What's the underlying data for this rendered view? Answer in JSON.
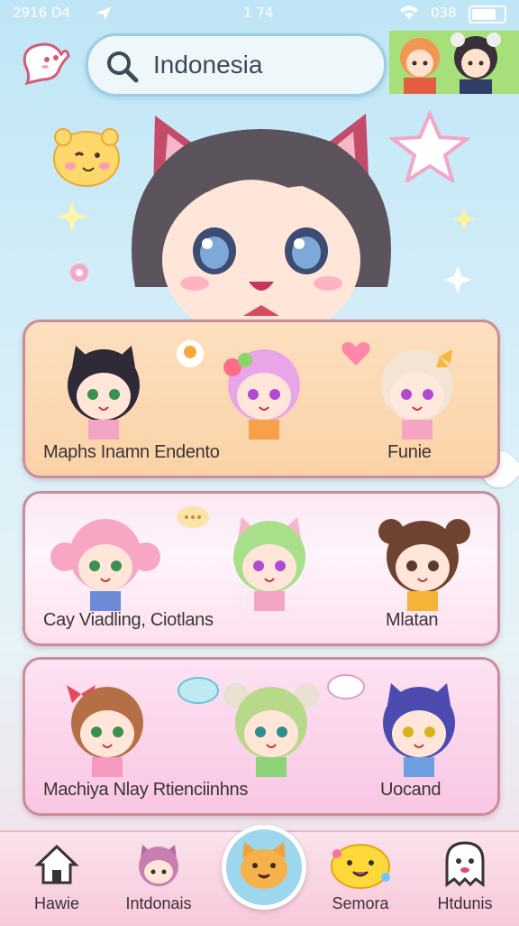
{
  "status_bar": {
    "left": "2916 D4",
    "center": "1 74",
    "right": "038"
  },
  "search": {
    "value": "Indonesia"
  },
  "cards": [
    {
      "left_label": "Maphs Inamn Endento",
      "right_label": "Funie"
    },
    {
      "left_label": "Cay Viadling, Ciotlans",
      "right_label": "Mlatan"
    },
    {
      "left_label": "Machiya Nlay Rtienciinhns",
      "right_label": "Uocand"
    }
  ],
  "nav": [
    {
      "label": "Hawie",
      "icon": "home-icon"
    },
    {
      "label": "Intdonais",
      "icon": "cat-avatar-icon"
    },
    {
      "label": "",
      "icon": "cat-face-icon"
    },
    {
      "label": "Semora",
      "icon": "yellow-mascot-icon"
    },
    {
      "label": "Htdunis",
      "icon": "ghost-icon"
    }
  ],
  "colors": {
    "accent_blue": "#9ccde3",
    "card_border": "#c98e9b",
    "nav_pink": "#f7c9db"
  }
}
